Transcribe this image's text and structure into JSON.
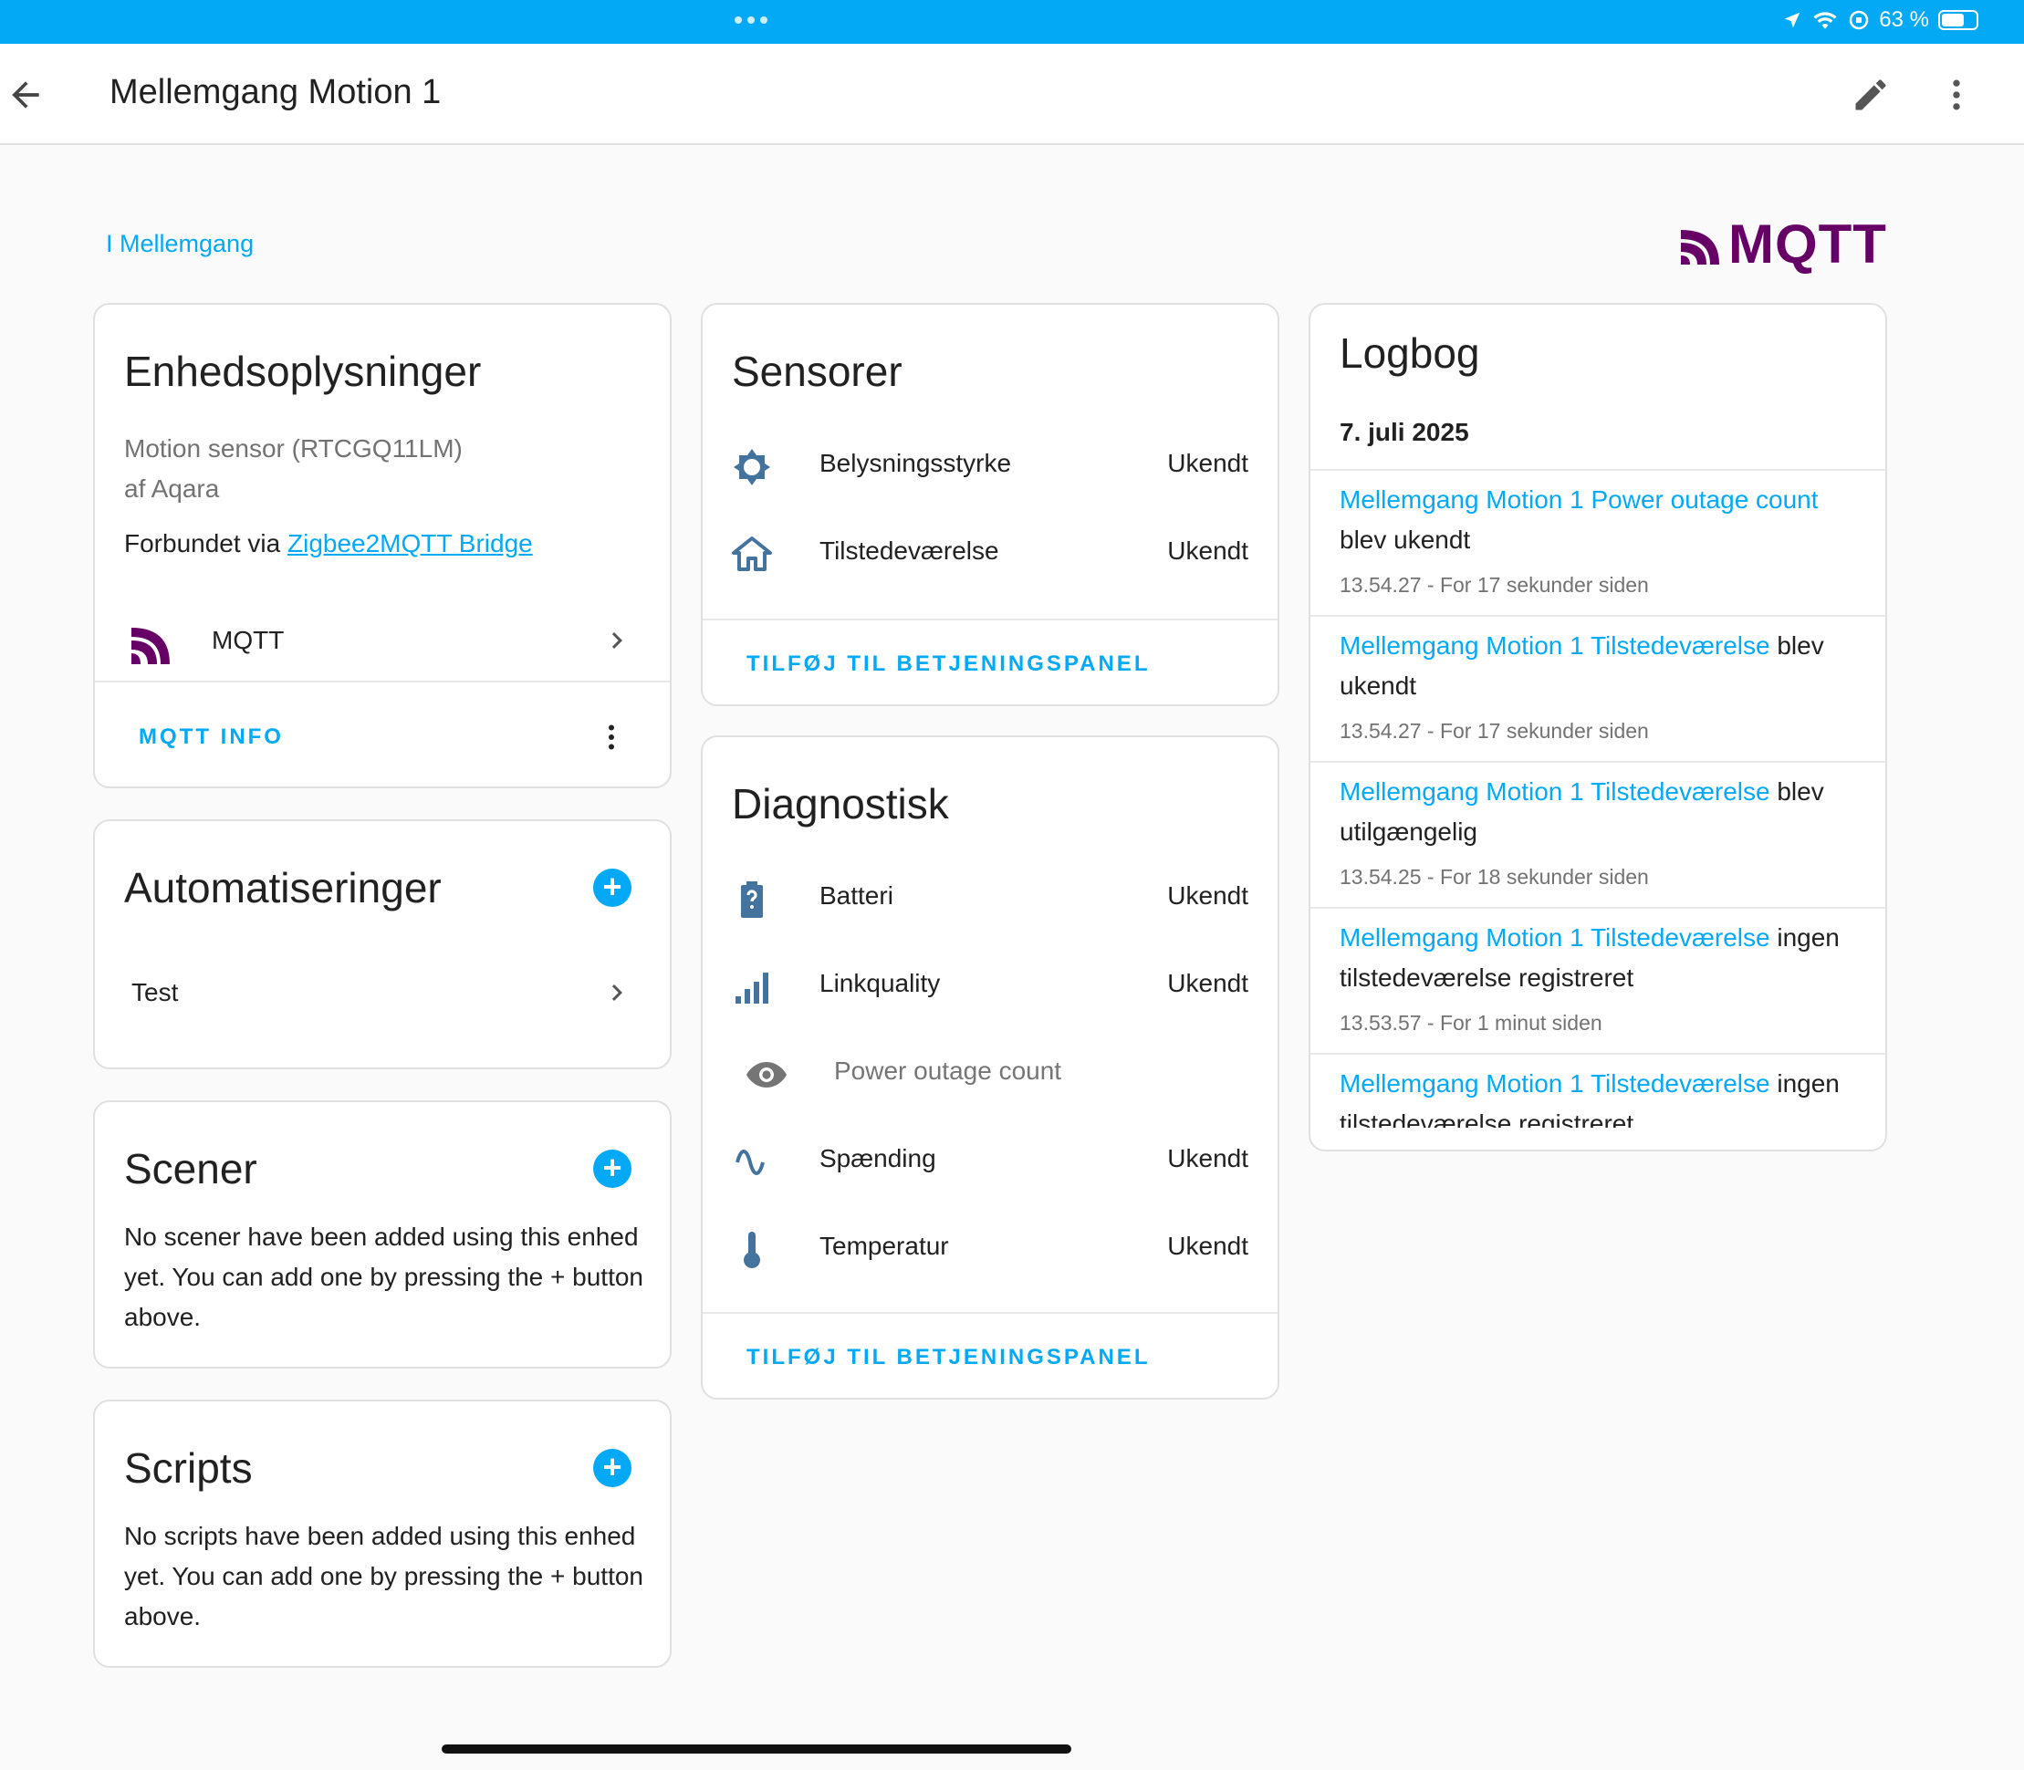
{
  "status_bar": {
    "battery": "63 %"
  },
  "header": {
    "title": "Mellemgang Motion 1"
  },
  "area": {
    "label": "Mellemgang"
  },
  "brand": {
    "logo_text": "MQTT",
    "color": "#660066"
  },
  "device_info": {
    "title": "Enhedsoplysninger",
    "model": "Motion sensor (RTCGQ11LM)",
    "manufacturer": "af Aqara",
    "connected_prefix": "Forbundet via ",
    "connected_link": "Zigbee2MQTT Bridge",
    "integration": "MQTT",
    "action": "MQTT INFO"
  },
  "automations": {
    "title": "Automatiseringer",
    "items": [
      "Test"
    ]
  },
  "scenes": {
    "title": "Scener",
    "empty": "No scener have been added using this enhed yet. You can add one by pressing the + button above."
  },
  "scripts": {
    "title": "Scripts",
    "empty": "No scripts have been added using this enhed yet. You can add one by pressing the + button above."
  },
  "sensors": {
    "title": "Sensorer",
    "rows": [
      {
        "icon": "brightness-icon",
        "name": "Belysningsstyrke",
        "state": "Ukendt"
      },
      {
        "icon": "home-icon",
        "name": "Tilstedeværelse",
        "state": "Ukendt"
      }
    ],
    "action": "TILFØJ TIL BETJENINGSPANEL"
  },
  "diagnostics": {
    "title": "Diagnostisk",
    "rows": [
      {
        "icon": "battery-unknown-icon",
        "name": "Batteri",
        "state": "Ukendt"
      },
      {
        "icon": "signal-icon",
        "name": "Linkquality",
        "state": "Ukendt"
      },
      {
        "icon": "eye-icon",
        "name": "Power outage count",
        "state": ""
      },
      {
        "icon": "sine-wave-icon",
        "name": "Spænding",
        "state": "Ukendt"
      },
      {
        "icon": "thermometer-icon",
        "name": "Temperatur",
        "state": "Ukendt"
      }
    ],
    "action": "TILFØJ TIL BETJENINGSPANEL"
  },
  "logbook": {
    "title": "Logbog",
    "date": "7. juli 2025",
    "entries": [
      {
        "entity": "Mellemgang Motion 1 Power outage count",
        "message": " blev ukendt",
        "time": "13.54.27 - For 17 sekunder siden"
      },
      {
        "entity": "Mellemgang Motion 1 Tilstedeværelse",
        "message": " blev ukendt",
        "time": "13.54.27 - For 17 sekunder siden"
      },
      {
        "entity": "Mellemgang Motion 1 Tilstedeværelse",
        "message": " blev utilgængelig",
        "time": "13.54.25 - For 18 sekunder siden"
      },
      {
        "entity": "Mellemgang Motion 1 Tilstedeværelse",
        "message": " ingen tilstedeværelse registreret",
        "time": "13.53.57 - For 1 minut siden"
      },
      {
        "entity": "Mellemgang Motion 1 Tilstedeværelse",
        "message": " ingen tilstedeværelse registreret",
        "time": ""
      }
    ]
  },
  "colors": {
    "accent": "#03a9f4",
    "icon": "#44739e",
    "text": "#212121",
    "secondary": "#727272"
  }
}
